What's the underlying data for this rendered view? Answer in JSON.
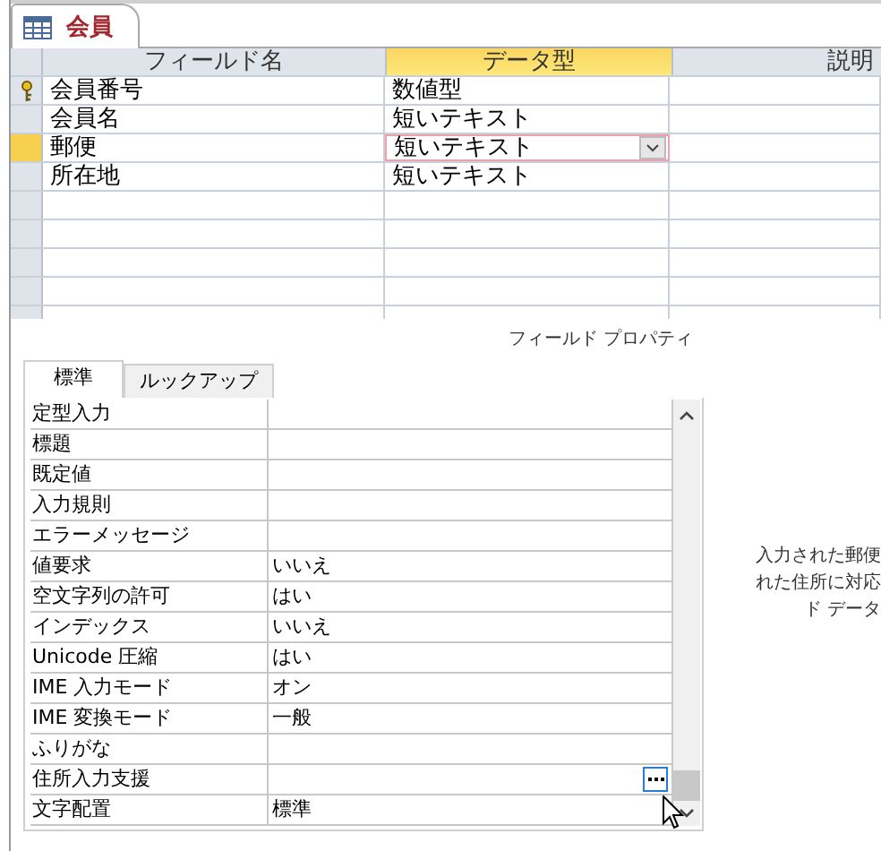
{
  "document_tab": {
    "title": "会員"
  },
  "grid": {
    "columns": [
      {
        "label": "フィールド名",
        "selected": false
      },
      {
        "label": "データ型",
        "selected": true
      },
      {
        "label": "説明",
        "selected": false
      }
    ],
    "rows": [
      {
        "field": "会員番号",
        "type": "数値型",
        "primary_key": true,
        "selected": false
      },
      {
        "field": "会員名",
        "type": "短いテキスト",
        "primary_key": false,
        "selected": false
      },
      {
        "field": "郵便",
        "type": "短いテキスト",
        "primary_key": false,
        "selected": true
      },
      {
        "field": "所在地",
        "type": "短いテキスト",
        "primary_key": false,
        "selected": false
      }
    ]
  },
  "field_properties": {
    "title": "フィールド プロパティ",
    "tabs": [
      {
        "label": "標準",
        "selected": true
      },
      {
        "label": "ルックアップ",
        "selected": false
      }
    ],
    "properties": [
      {
        "name": "定型入力",
        "builder": false
      },
      {
        "name": "標題",
        "builder": false
      },
      {
        "name": "既定値",
        "builder": false
      },
      {
        "name": "入力規則",
        "builder": false
      },
      {
        "name": "エラーメッセージ",
        "builder": false
      },
      {
        "name": "値要求",
        "value": "いいえ",
        "builder": false
      },
      {
        "name": "空文字列の許可",
        "value": "はい",
        "builder": false
      },
      {
        "name": "インデックス",
        "value": "いいえ",
        "builder": false
      },
      {
        "name": "Unicode 圧縮",
        "value": "はい",
        "builder": false
      },
      {
        "name": "IME 入力モード",
        "value": "オン",
        "builder": false
      },
      {
        "name": "IME 変換モード",
        "value": "一般",
        "builder": false
      },
      {
        "name": "ふりがな",
        "builder": false
      },
      {
        "name": "住所入力支援",
        "builder": true
      },
      {
        "name": "文字配置",
        "value": "標準",
        "builder": false
      }
    ],
    "help_text": [
      "入力された郵便",
      "れた住所に対応",
      "ド データ"
    ]
  }
}
